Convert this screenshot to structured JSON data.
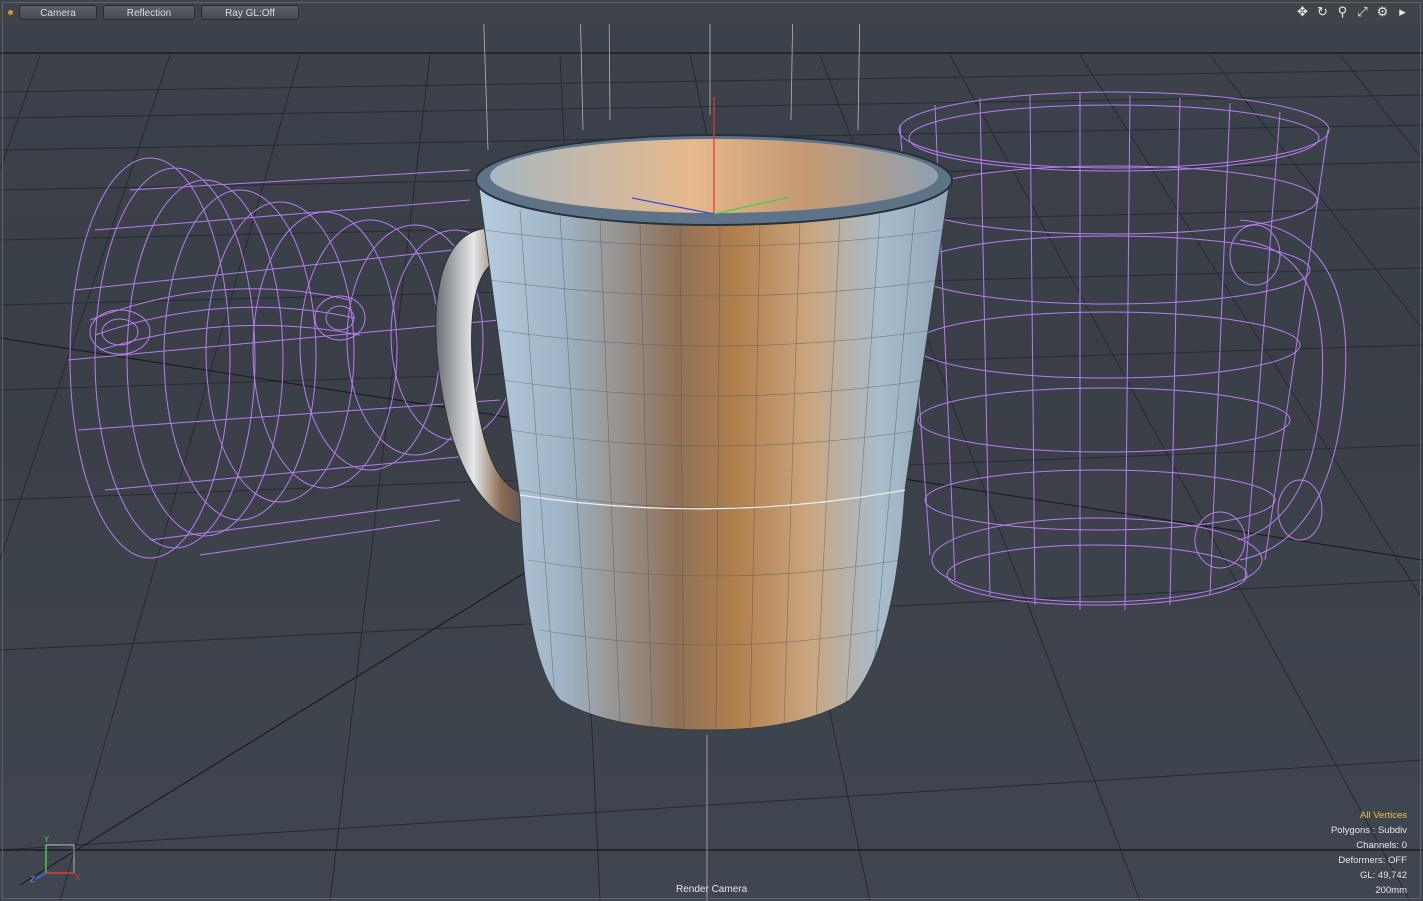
{
  "toolbar": {
    "camera_label": "Camera",
    "reflection_label": "Reflection",
    "raygl_label": "Ray GL:Off"
  },
  "nav_icons": [
    "move-icon",
    "rotate-icon",
    "zoom-icon",
    "maximize-icon",
    "gear-icon",
    "menu-arrow-icon"
  ],
  "status": {
    "selection_mode": "All Vertices",
    "polygons": "Polygons : Subdiv",
    "channels": "Channels: 0",
    "deformers": "Deformers: OFF",
    "gl": "GL: 49,742",
    "grid_size": "200mm"
  },
  "footer": {
    "camera_name": "Render Camera"
  },
  "axis": {
    "x": "X",
    "y": "Y",
    "z": "Z"
  },
  "colors": {
    "accent": "#f0c048",
    "wireframe": "#b77cf0",
    "grid": "#1f2226",
    "background": "#3c424b"
  }
}
